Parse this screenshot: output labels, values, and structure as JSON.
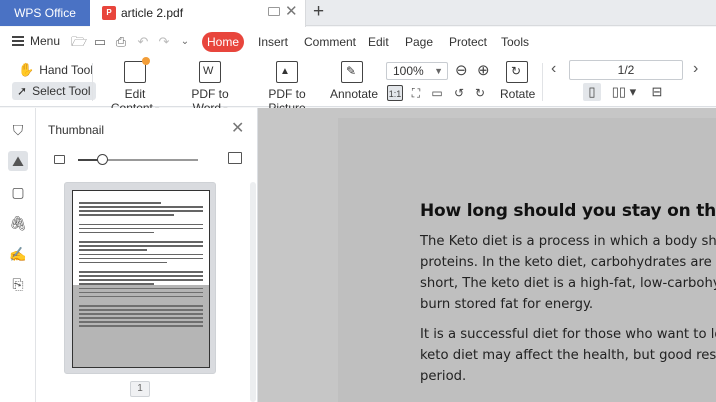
{
  "tabs": {
    "app": "WPS Office",
    "document": "article 2.pdf"
  },
  "menu": {
    "menu_label": "Menu",
    "items": [
      "Home",
      "Insert",
      "Comment",
      "Edit",
      "Page",
      "Protect",
      "Tools"
    ]
  },
  "toolbar": {
    "hand_tool": "Hand Tool",
    "select_tool": "Select Tool",
    "edit_content": "Edit Content",
    "pdf_to_word": "PDF to Word",
    "pdf_to_picture": "PDF to Picture",
    "annotate": "Annotate",
    "zoom": "100%",
    "rotate": "Rotate",
    "page_indicator": "1/2"
  },
  "thumbnail_panel": {
    "title": "Thumbnail",
    "page_number": "1",
    "slider_level": 0.2
  },
  "document": {
    "heading": "How long should you stay on the ke",
    "paragraph1": [
      "The Keto diet is a process in which a body shift",
      "proteins. In the keto diet, carbohydrates are us",
      "short, The keto diet is a high-fat, low-carbohyd",
      "burn stored fat for energy."
    ],
    "paragraph2": [
      "It is a successful diet for those who want to los",
      "keto diet may affect the health, but good resul",
      "period."
    ]
  },
  "colors": {
    "brand_blue": "#4a72c4",
    "accent_red": "#e8453c"
  }
}
